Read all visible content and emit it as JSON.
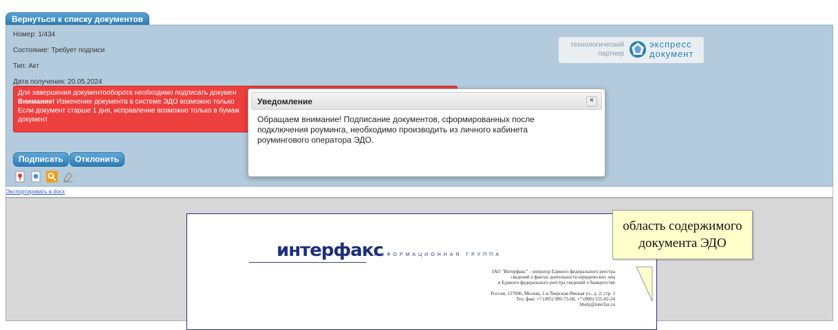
{
  "nav": {
    "back_label": "Вернуться к списку документов"
  },
  "doc_info": {
    "number": "Номер: 1/434",
    "status": "Состояние: Требует подписи",
    "type": "Тип: Акт",
    "date": "Дата получения: 20.05.2024"
  },
  "alert": {
    "line1": "Для завершения документооборота необходимо подписать докумен",
    "line2_bold": "Внимание!",
    "line2_rest": " Изменение документа в системе ЭДО возможно только",
    "line3": "Если документ старше 1 дня, исправление возможно только в бумаж",
    "line4": "документ"
  },
  "partner_logo": {
    "left_line1": "технологический",
    "left_line2": "партнер",
    "right_line1": "экспресс",
    "right_line2": "документ"
  },
  "actions": {
    "sign_label": "Подписать",
    "reject_label": "Отклонить"
  },
  "export": {
    "link_label": "Экспортировать в docx"
  },
  "document": {
    "brand": "интерфакс",
    "tagline": "ИНФОРМАЦИОННАЯ ГРУППА",
    "company_line1": "ЗАО \"Интерфакс\" - оператор Единого федерального реестра",
    "company_line2": "сведений о фактах деятельности юридических лиц",
    "company_line3": "и Единого федерального реестра сведений о банкротстве",
    "address_line1": "Россия, 127006, Москва, 1-я Тверская-Ямская ул., д. 2, стр. 1",
    "address_line2": "Тел. факс +7 (495) 989-73-68, +7 (800) 555-02-24",
    "address_line3": "bhelp@interfax.ru"
  },
  "callout": {
    "line1": "область содержимого",
    "line2": "документа ЭДО"
  },
  "modal": {
    "title": "Уведомление",
    "close_glyph": "×",
    "body": "Обращаем внимание! Подписание документов, сформированных после подключения роуминга, необходимо производить из личного кабинета роумингового оператора ЭДО."
  },
  "colors": {
    "panel": "#b3cbdc",
    "alert": "#ee3f3f",
    "button": "#2d7cb6",
    "callout": "#ffffcc"
  }
}
